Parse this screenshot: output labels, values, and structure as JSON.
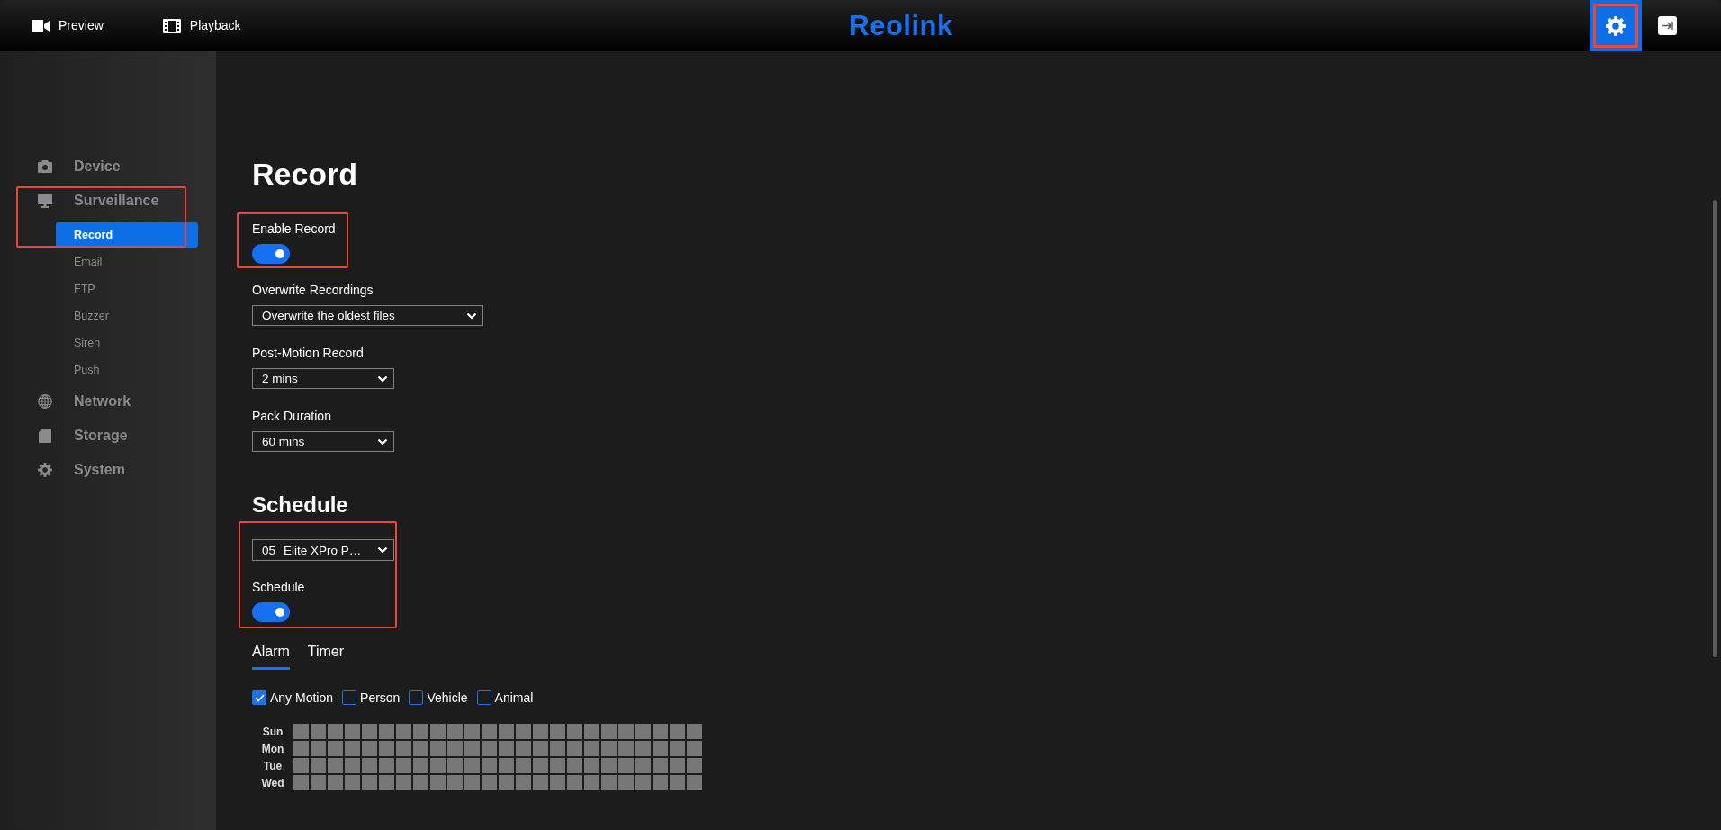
{
  "top_bar": {
    "nav": [
      {
        "label": "Preview"
      },
      {
        "label": "Playback"
      }
    ],
    "logo": "Reolink",
    "settings_button": {
      "selected": true,
      "highlighted": true
    }
  },
  "sidebar": {
    "sections": [
      {
        "label": "Device",
        "highlighted": false
      },
      {
        "label": "Surveillance",
        "highlighted": true,
        "children": [
          {
            "label": "Record",
            "selected": true
          },
          {
            "label": "Email",
            "selected": false
          },
          {
            "label": "FTP",
            "selected": false
          },
          {
            "label": "Buzzer",
            "selected": false
          },
          {
            "label": "Siren",
            "selected": false
          },
          {
            "label": "Push",
            "selected": false
          }
        ]
      },
      {
        "label": "Network",
        "highlighted": false
      },
      {
        "label": "Storage",
        "highlighted": false
      },
      {
        "label": "System",
        "highlighted": false
      }
    ]
  },
  "page": {
    "title": "Record",
    "enable_record": {
      "label": "Enable Record",
      "on": true,
      "highlighted": true
    },
    "fields": [
      {
        "label": "Overwrite Recordings",
        "value": "Overwrite the oldest files"
      },
      {
        "label": "Post-Motion Record",
        "value": "2 mins"
      },
      {
        "label": "Pack Duration",
        "value": "60 mins"
      }
    ],
    "schedule": {
      "title": "Schedule",
      "highlighted": true,
      "channel": {
        "number": "05",
        "value": "Elite XPro P…"
      },
      "toggle": {
        "label": "Schedule",
        "on": true
      },
      "tabs": [
        {
          "label": "Alarm",
          "selected": true
        },
        {
          "label": "Timer",
          "selected": false
        }
      ],
      "filters": [
        {
          "label": "Any Motion",
          "checked": true
        },
        {
          "label": "Person",
          "checked": false
        },
        {
          "label": "Vehicle",
          "checked": false
        },
        {
          "label": "Animal",
          "checked": false
        }
      ],
      "grid": [
        {
          "day": "Sun",
          "hours": [
            false,
            false,
            false,
            false,
            false,
            false,
            false,
            false,
            false,
            false,
            false,
            false,
            false,
            false,
            false,
            false,
            false,
            false,
            false,
            false,
            false,
            false,
            false,
            false
          ]
        },
        {
          "day": "Mon",
          "hours": [
            false,
            false,
            false,
            false,
            false,
            false,
            false,
            false,
            false,
            false,
            false,
            false,
            false,
            false,
            false,
            false,
            false,
            false,
            false,
            false,
            false,
            false,
            false,
            false
          ]
        },
        {
          "day": "Tue",
          "hours": [
            false,
            false,
            false,
            false,
            false,
            false,
            false,
            false,
            false,
            false,
            false,
            false,
            false,
            false,
            false,
            false,
            false,
            false,
            false,
            false,
            false,
            false,
            false,
            false
          ]
        },
        {
          "day": "Wed",
          "hours": [
            false,
            false,
            false,
            false,
            false,
            false,
            false,
            false,
            false,
            false,
            false,
            false,
            false,
            false,
            false,
            false,
            false,
            false,
            false,
            false,
            false,
            false,
            false,
            false
          ]
        }
      ]
    }
  }
}
